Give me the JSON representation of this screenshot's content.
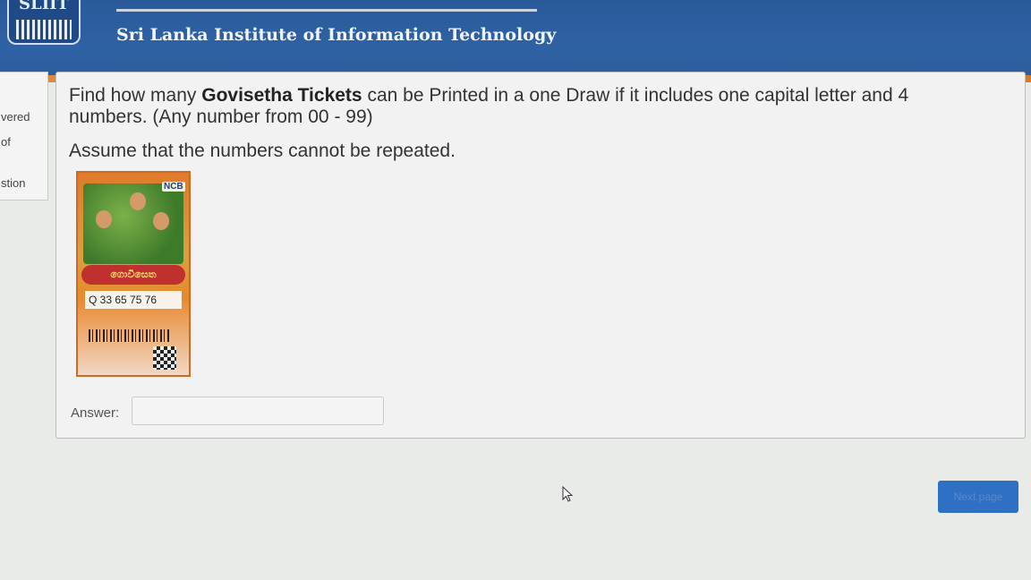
{
  "header": {
    "logo_text": "SLIIT",
    "institute_name": "Sri Lanka Institute of Information Technology"
  },
  "sidebar": {
    "items": [
      "vered",
      "of",
      "stion"
    ]
  },
  "question": {
    "line1_pre": "Find how many ",
    "line1_bold": "Govisetha Tickets",
    "line1_post": " can be Printed in a one Draw if it includes one capital letter and 4",
    "line2": "numbers. (Any number from 00 - 99)",
    "line3": "Assume that the numbers cannot be repeated."
  },
  "ticket": {
    "brand": "NCB",
    "title": "ගොවිසෙත",
    "numbers": "Q 33 65 75 76"
  },
  "answer": {
    "label": "Answer:",
    "value": ""
  },
  "next_button": "Next page"
}
